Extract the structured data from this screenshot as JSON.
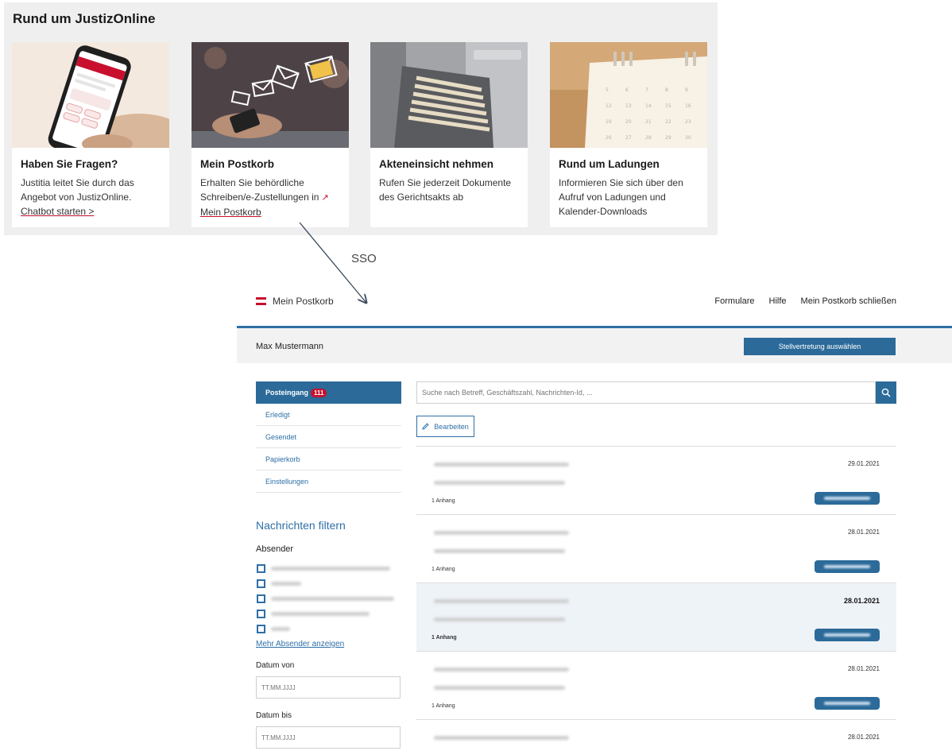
{
  "justizonline": {
    "title": "Rund um JustizOnline",
    "cards": [
      {
        "heading": "Haben Sie Fragen?",
        "text": "Justitia leitet Sie durch das Angebot von JustizOnline.",
        "link": "Chatbot starten >"
      },
      {
        "heading": "Mein Postkorb",
        "text": "Erhalten Sie behördliche Schreiben/e-Zustellungen in",
        "link": "Mein Postkorb"
      },
      {
        "heading": "Akteneinsicht nehmen",
        "text": "Rufen Sie jederzeit Dokumente des Gerichtsakts ab",
        "link": ""
      },
      {
        "heading": "Rund um Ladungen",
        "text": "Informieren Sie sich über den Aufruf von Ladungen und Kalender-Downloads",
        "link": ""
      }
    ]
  },
  "arrow": {
    "label": "SSO"
  },
  "postkorb": {
    "app_title": "Mein Postkorb",
    "nav": [
      "Formulare",
      "Hilfe",
      "Mein Postkorb schließen"
    ],
    "user_name": "Max Mustermann",
    "stellvertretung_label": "Stellvertretung auswählen",
    "sidebar": {
      "folders": [
        {
          "label": "Posteingang",
          "badge": "111"
        },
        {
          "label": "Erledigt"
        },
        {
          "label": "Gesendet"
        },
        {
          "label": "Papierkorb"
        },
        {
          "label": "Einstellungen"
        }
      ],
      "filter_title": "Nachrichten filtern",
      "sender_label": "Absender",
      "more_senders": "Mehr Absender anzeigen",
      "date_from_label": "Datum von",
      "date_from_placeholder": "TT.MM.JJJJ",
      "date_to_label": "Datum bis",
      "date_to_placeholder": "TT.MM.JJJJ"
    },
    "search_placeholder": "Suche nach Betreff, Geschäftszahl, Nachrichten-Id, ...",
    "edit_label": "Bearbeiten",
    "messages": [
      {
        "date": "29.01.2021",
        "attachments": "1 Anhang"
      },
      {
        "date": "28.01.2021",
        "attachments": "1 Anhang"
      },
      {
        "date": "28.01.2021",
        "attachments": "1 Anhang"
      },
      {
        "date": "28.01.2021",
        "attachments": "1 Anhang"
      },
      {
        "date": "28.01.2021",
        "attachments": ""
      }
    ]
  },
  "colors": {
    "accent": "#2b6a99",
    "brand_red": "#c8102e"
  }
}
